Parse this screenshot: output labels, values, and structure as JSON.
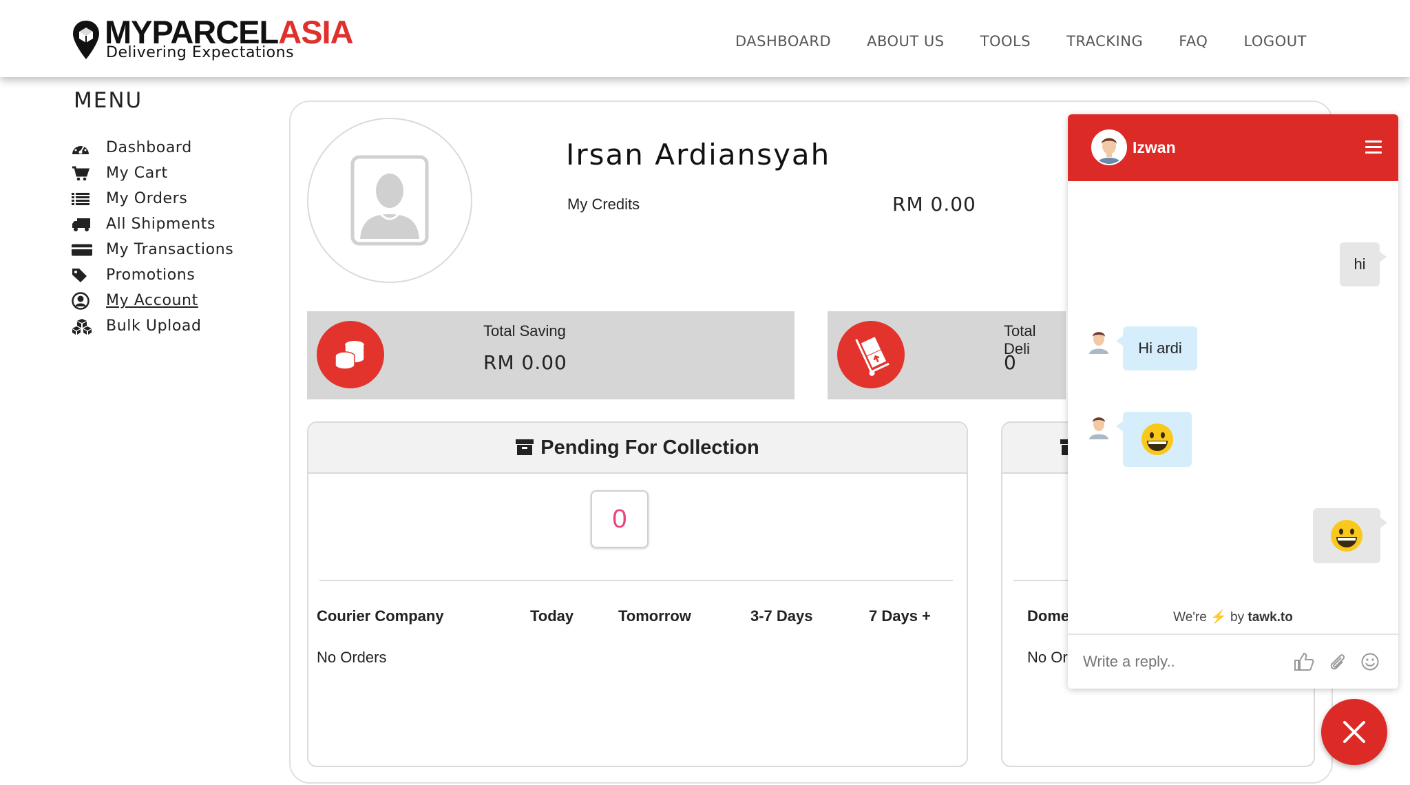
{
  "brand": {
    "name_part1": "MYPARCEL",
    "name_part2": "ASIA",
    "tagline": "Delivering Expectations",
    "accent_color": "#e0302e"
  },
  "nav": {
    "items": [
      {
        "label": "DASHBOARD"
      },
      {
        "label": "ABOUT US"
      },
      {
        "label": "TOOLS"
      },
      {
        "label": "TRACKING"
      },
      {
        "label": "FAQ"
      },
      {
        "label": "LOGOUT"
      }
    ]
  },
  "sidebar": {
    "title": "MENU",
    "items": [
      {
        "label": "Dashboard",
        "icon": "dashboard-icon"
      },
      {
        "label": "My Cart",
        "icon": "cart-icon"
      },
      {
        "label": "My Orders",
        "icon": "list-icon"
      },
      {
        "label": "All Shipments",
        "icon": "truck-icon"
      },
      {
        "label": "My Transactions",
        "icon": "credit-card-icon"
      },
      {
        "label": "Promotions",
        "icon": "tag-icon"
      },
      {
        "label": "My Account",
        "icon": "user-circle-icon",
        "active": true
      },
      {
        "label": "Bulk Upload",
        "icon": "cubes-icon"
      }
    ]
  },
  "profile": {
    "name": "Irsan Ardiansyah",
    "credits_label": "My Credits",
    "credits_value": "RM 0.00"
  },
  "stats": {
    "saving": {
      "title": "Total Saving",
      "value": "RM 0.00",
      "icon": "coins-icon"
    },
    "deliveries": {
      "title": "Total Deli",
      "value": "0",
      "icon": "hand-truck-icon"
    }
  },
  "pending": {
    "title": "Pending For Collection",
    "count": "0",
    "columns": [
      "Courier Company",
      "Today",
      "Tomorrow",
      "3-7 Days",
      "7 Days +"
    ],
    "empty_text": "No Orders"
  },
  "second_panel": {
    "column_first": "Dome",
    "empty_text": "No Or"
  },
  "chat": {
    "agent_name": "Izwan",
    "messages": [
      {
        "from": "visitor",
        "text": "hi"
      },
      {
        "from": "agent",
        "text": "Hi ardi"
      },
      {
        "from": "agent",
        "text": "",
        "emoji": "grinning-face"
      },
      {
        "from": "visitor",
        "text": "",
        "emoji": "grinning-face"
      }
    ],
    "powered_prefix": "We're",
    "powered_by": "by",
    "powered_brand": "tawk.to",
    "input_placeholder": "Write a reply..",
    "header_color": "#dc2a27"
  }
}
